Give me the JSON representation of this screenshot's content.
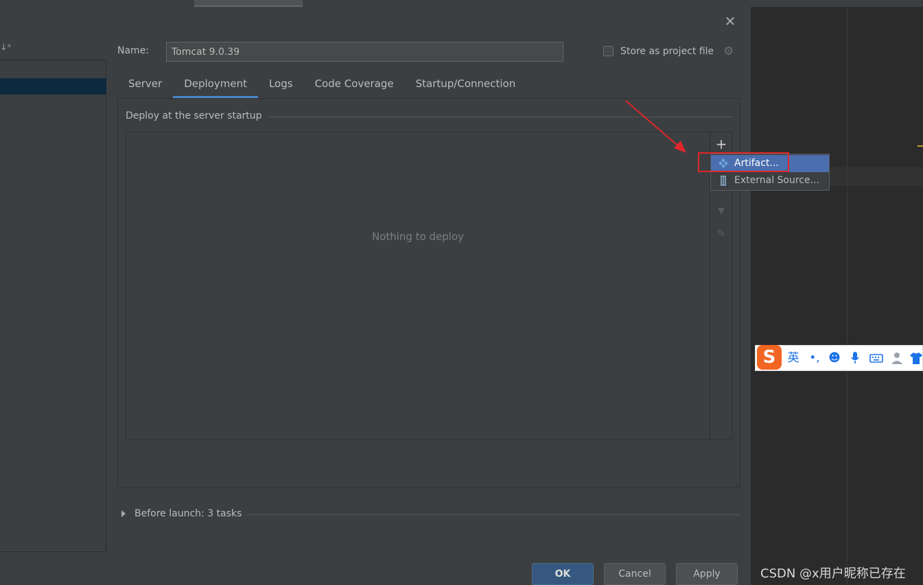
{
  "dialog": {
    "close_icon": "close-icon",
    "name_label": "Name:",
    "name_value": "Tomcat 9.0.39",
    "store_label": "Store as project file",
    "store_checked": false
  },
  "tabs": [
    {
      "label": "Server",
      "active": false
    },
    {
      "label": "Deployment",
      "active": true
    },
    {
      "label": "Logs",
      "active": false
    },
    {
      "label": "Code Coverage",
      "active": false
    },
    {
      "label": "Startup/Connection",
      "active": false
    }
  ],
  "deployment": {
    "section_title": "Deploy at the server startup",
    "empty_text": "Nothing to deploy",
    "toolbar": {
      "add": "+",
      "move_down": "▼",
      "edit": "✎"
    }
  },
  "popup_menu": {
    "items": [
      {
        "label": "Artifact...",
        "icon": "artifact-icon",
        "selected": true
      },
      {
        "label": "External Source...",
        "icon": "external-source-icon",
        "selected": false
      }
    ]
  },
  "before_launch": {
    "label": "Before launch: 3 tasks"
  },
  "buttons": {
    "ok": "OK",
    "cancel": "Cancel",
    "apply": "Apply"
  },
  "ime": {
    "logo": "S",
    "lang": "英",
    "punct": "•,"
  },
  "watermark": "CSDN @x用户昵称已存在",
  "colors": {
    "accent": "#4a88c7",
    "menu_selected": "#4b6eaf",
    "highlight_red": "#e0262b",
    "ok_button": "#365880"
  }
}
